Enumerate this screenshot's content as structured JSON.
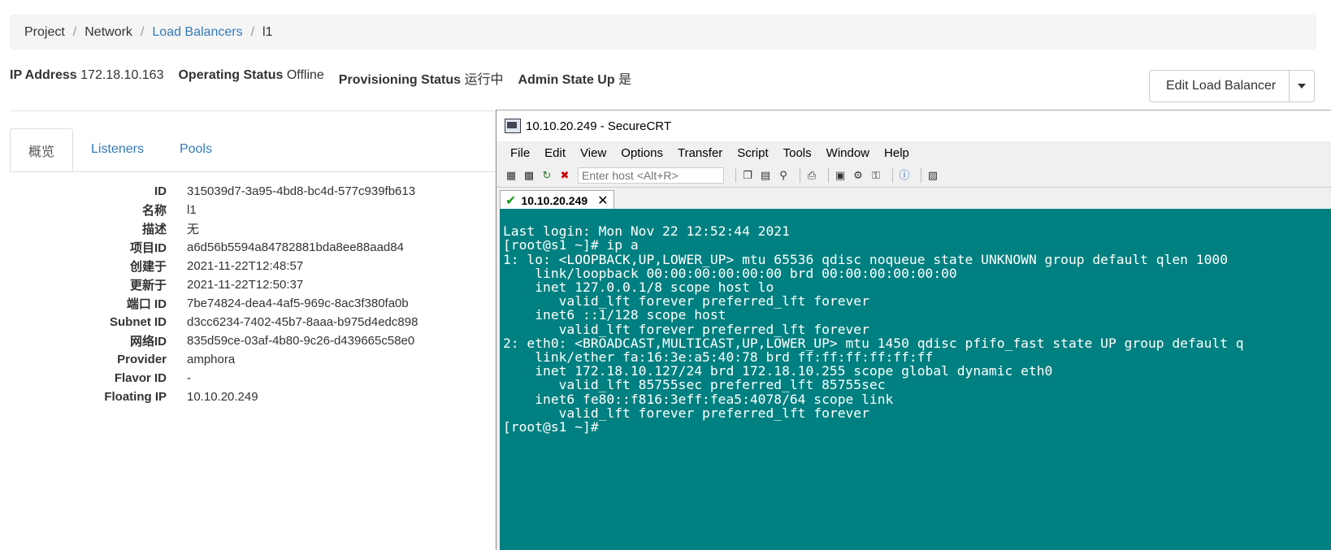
{
  "breadcrumb": {
    "items": [
      "Project",
      "Network",
      "Load Balancers",
      "l1"
    ],
    "separator": "/"
  },
  "status": {
    "ip_label": "IP Address",
    "ip_value": "172.18.10.163",
    "operating_label": "Operating Status",
    "operating_value": "Offline",
    "provisioning_label": "Provisioning Status",
    "provisioning_value": "运行中",
    "admin_label": "Admin State Up",
    "admin_value": "是"
  },
  "actions": {
    "edit_label": "Edit Load Balancer"
  },
  "tabs": [
    {
      "label": "概览",
      "active": true
    },
    {
      "label": "Listeners",
      "active": false
    },
    {
      "label": "Pools",
      "active": false
    }
  ],
  "details": [
    {
      "key": "ID",
      "value": "315039d7-3a95-4bd8-bc4d-577c939fb613"
    },
    {
      "key": "名称",
      "value": "l1"
    },
    {
      "key": "描述",
      "value": "无"
    },
    {
      "key": "项目ID",
      "value": "a6d56b5594a84782881bda8ee88aad84"
    },
    {
      "key": "创建于",
      "value": "2021-11-22T12:48:57"
    },
    {
      "key": "更新于",
      "value": "2021-11-22T12:50:37"
    },
    {
      "key": "端口 ID",
      "value": "7be74824-dea4-4af5-969c-8ac3f380fa0b"
    },
    {
      "key": "Subnet ID",
      "value": "d3cc6234-7402-45b7-8aaa-b975d4edc898"
    },
    {
      "key": "网络ID",
      "value": "835d59ce-03af-4b80-9c26-d439665c58e0"
    },
    {
      "key": "Provider",
      "value": "amphora"
    },
    {
      "key": "Flavor ID",
      "value": "-"
    },
    {
      "key": "Floating IP",
      "value": "10.10.20.249"
    }
  ],
  "securecrt": {
    "title": "10.10.20.249 - SecureCRT",
    "menu": [
      "File",
      "Edit",
      "View",
      "Options",
      "Transfer",
      "Script",
      "Tools",
      "Window",
      "Help"
    ],
    "host_placeholder": "Enter host <Alt+R>",
    "session_tab": "10.10.20.249",
    "terminal_lines": [
      "Last login: Mon Nov 22 12:52:44 2021",
      "[root@s1 ~]# ip a",
      "1: lo: <LOOPBACK,UP,LOWER_UP> mtu 65536 qdisc noqueue state UNKNOWN group default qlen 1000",
      "    link/loopback 00:00:00:00:00:00 brd 00:00:00:00:00:00",
      "    inet 127.0.0.1/8 scope host lo",
      "       valid_lft forever preferred_lft forever",
      "    inet6 ::1/128 scope host",
      "       valid_lft forever preferred_lft forever",
      "2: eth0: <BROADCAST,MULTICAST,UP,LOWER_UP> mtu 1450 qdisc pfifo_fast state UP group default q",
      "    link/ether fa:16:3e:a5:40:78 brd ff:ff:ff:ff:ff:ff",
      "    inet 172.18.10.127/24 brd 172.18.10.255 scope global dynamic eth0",
      "       valid_lft 85755sec preferred_lft 85755sec",
      "    inet6 fe80::f816:3eff:fea5:4078/64 scope link",
      "       valid_lft forever preferred_lft forever",
      "[root@s1 ~]# "
    ]
  },
  "colors": {
    "link": "#337ab7",
    "terminal_bg": "#008080",
    "terminal_fg": "#ffffff"
  }
}
